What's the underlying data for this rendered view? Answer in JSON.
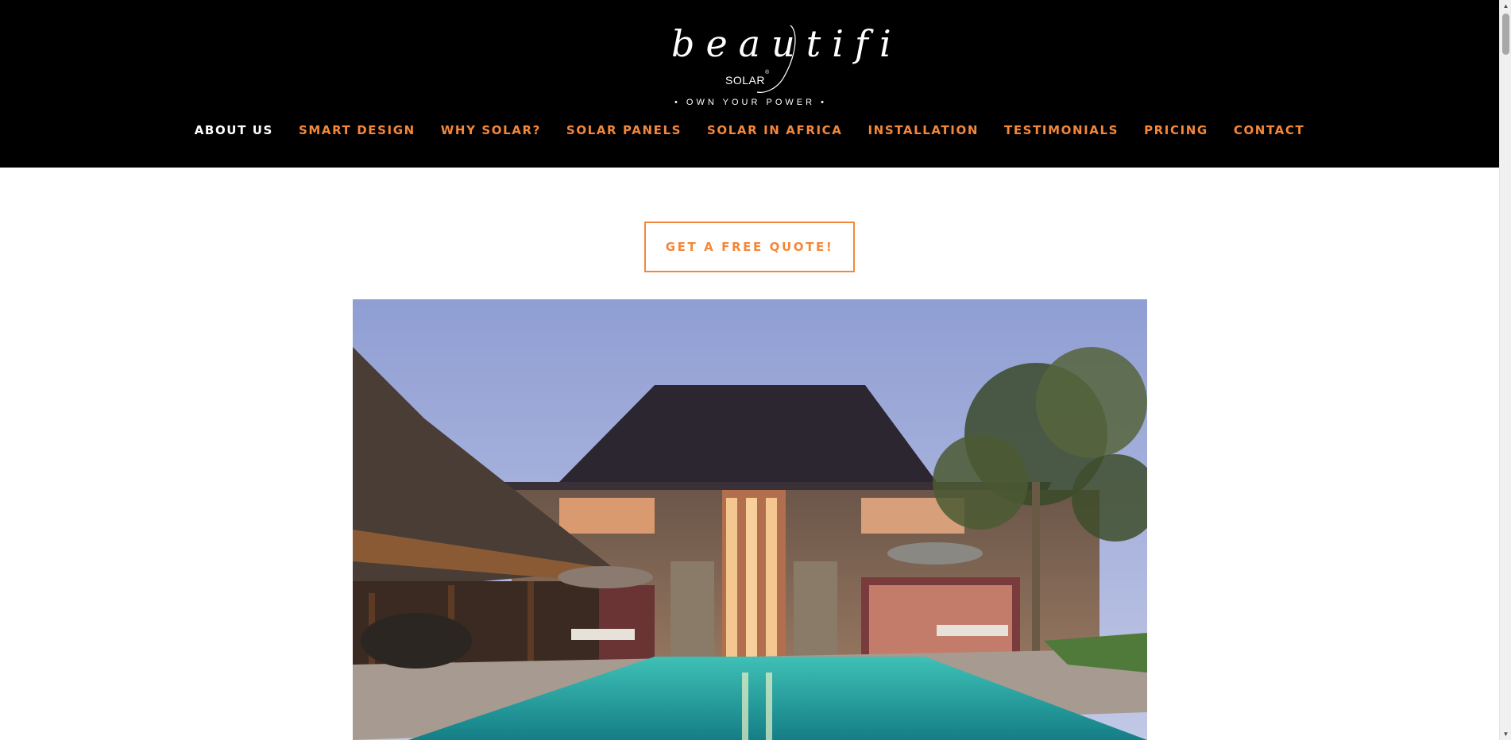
{
  "brand": {
    "logo_word": "beautifi",
    "logo_sub": "SOLAR",
    "registered_mark": "®",
    "tagline": "• OWN YOUR POWER •"
  },
  "nav": {
    "items": [
      {
        "label": "ABOUT US",
        "active": true
      },
      {
        "label": "SMART DESIGN",
        "active": false
      },
      {
        "label": "WHY SOLAR?",
        "active": false
      },
      {
        "label": "SOLAR PANELS",
        "active": false
      },
      {
        "label": "SOLAR IN AFRICA",
        "active": false
      },
      {
        "label": "INSTALLATION",
        "active": false
      },
      {
        "label": "TESTIMONIALS",
        "active": false
      },
      {
        "label": "PRICING",
        "active": false
      },
      {
        "label": "CONTACT",
        "active": false
      }
    ]
  },
  "cta": {
    "label": "GET A FREE QUOTE!"
  },
  "hero": {
    "subject": "villa-with-pool-at-dusk"
  },
  "scrollbar": {
    "up_icon": "▲",
    "down_icon": "▼"
  },
  "colors": {
    "accent": "#f58739",
    "header_bg": "#000000",
    "nav_active": "#ffffff",
    "page_bg": "#ffffff"
  }
}
